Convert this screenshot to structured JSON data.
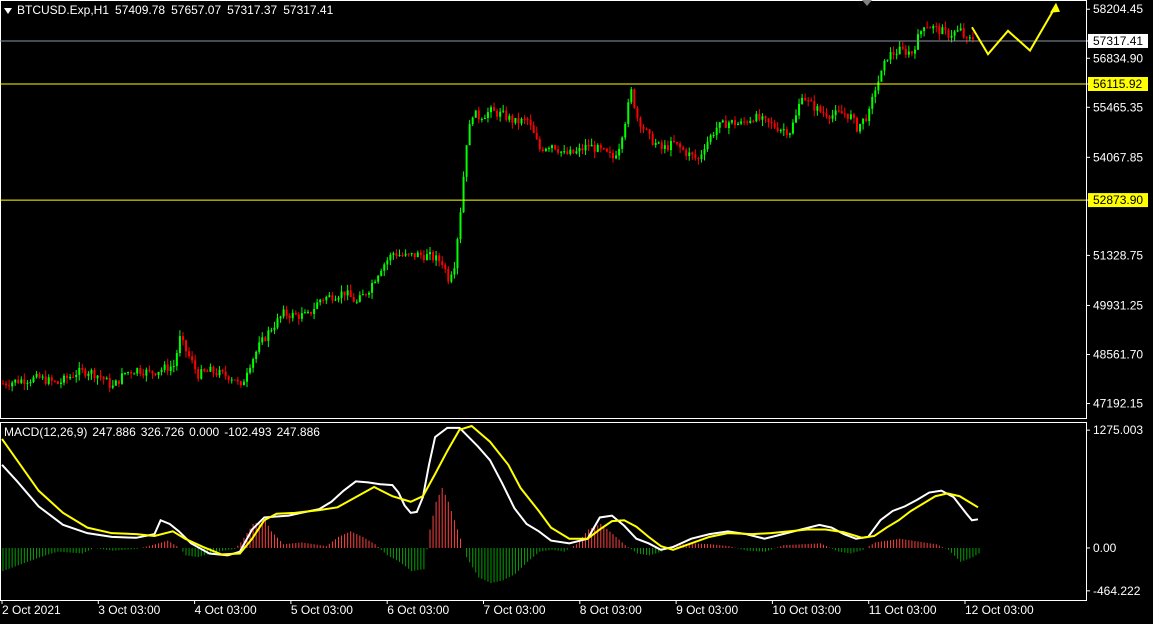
{
  "header": {
    "symbol": "BTCUSD.Exp,H1",
    "open": "57409.78",
    "high": "57657.07",
    "low": "57317.37",
    "close": "57317.41"
  },
  "macd_header": {
    "name": "MACD(12,26,9)",
    "v1": "247.886",
    "v2": "326.726",
    "v3": "0.000",
    "v4": "-102.493",
    "v5": "247.886"
  },
  "colors": {
    "background": "#000000",
    "grid_frame": "#ffffff",
    "bull_candle": "#00ff00",
    "bear_candle": "#ff0000",
    "level_line": "#ffff00",
    "current_price_line": "#8a93a6",
    "macd_line": "#ffffff",
    "signal_line": "#ffff00",
    "hist_positive": "#ff4040",
    "hist_negative": "#00a000",
    "arrow": "#ffff00"
  },
  "chart_data": [
    {
      "type": "candlestick",
      "price_axis_labels": [
        "58204.45",
        "57317.41",
        "56834.90",
        "56115.92",
        "55465.35",
        "54067.85",
        "52873.90",
        "51328.75",
        "49931.25",
        "48561.70",
        "47192.15"
      ],
      "ylim": [
        46900,
        58350
      ],
      "current_price": 57317.41,
      "horizontal_levels": [
        {
          "label": "56115.92",
          "value": 56115.92
        },
        {
          "label": "52873.90",
          "value": 52873.9
        }
      ],
      "time_labels": [
        "2 Oct 2021",
        "3 Oct 03:00",
        "4 Oct 03:00",
        "5 Oct 03:00",
        "6 Oct 03:00",
        "7 Oct 03:00",
        "8 Oct 03:00",
        "9 Oct 03:00",
        "10 Oct 03:00",
        "11 Oct 03:00",
        "12 Oct 03:00"
      ],
      "price_path": [
        [
          0,
          47750
        ],
        [
          6,
          47850
        ],
        [
          12,
          47900
        ],
        [
          18,
          47750
        ],
        [
          24,
          48050
        ],
        [
          28,
          48100
        ],
        [
          32,
          47950
        ],
        [
          36,
          47650
        ],
        [
          40,
          48050
        ],
        [
          44,
          48150
        ],
        [
          48,
          48050
        ],
        [
          52,
          48150
        ],
        [
          56,
          48250
        ],
        [
          58,
          49000
        ],
        [
          61,
          48500
        ],
        [
          64,
          48000
        ],
        [
          68,
          48100
        ],
        [
          72,
          48000
        ],
        [
          76,
          47900
        ],
        [
          78,
          47600
        ],
        [
          80,
          48150
        ],
        [
          84,
          48800
        ],
        [
          88,
          49300
        ],
        [
          92,
          49700
        ],
        [
          96,
          49650
        ],
        [
          100,
          49650
        ],
        [
          104,
          50100
        ],
        [
          108,
          50200
        ],
        [
          112,
          50300
        ],
        [
          116,
          50000
        ],
        [
          120,
          50400
        ],
        [
          124,
          51000
        ],
        [
          128,
          51400
        ],
        [
          132,
          51300
        ],
        [
          136,
          51350
        ],
        [
          140,
          51300
        ],
        [
          144,
          51150
        ],
        [
          146,
          50700
        ],
        [
          148,
          51100
        ],
        [
          150,
          52600
        ],
        [
          152,
          54500
        ],
        [
          154,
          55300
        ],
        [
          156,
          55200
        ],
        [
          160,
          55350
        ],
        [
          164,
          55250
        ],
        [
          168,
          55050
        ],
        [
          172,
          55100
        ],
        [
          176,
          54300
        ],
        [
          180,
          54450
        ],
        [
          184,
          54150
        ],
        [
          188,
          54200
        ],
        [
          192,
          54400
        ],
        [
          196,
          54250
        ],
        [
          200,
          54050
        ],
        [
          202,
          54400
        ],
        [
          204,
          55100
        ],
        [
          206,
          55900
        ],
        [
          208,
          55200
        ],
        [
          212,
          54600
        ],
        [
          216,
          54300
        ],
        [
          220,
          54450
        ],
        [
          224,
          54200
        ],
        [
          228,
          54000
        ],
        [
          230,
          54400
        ],
        [
          234,
          54900
        ],
        [
          238,
          55050
        ],
        [
          242,
          55000
        ],
        [
          246,
          55200
        ],
        [
          250,
          55050
        ],
        [
          254,
          54900
        ],
        [
          258,
          54800
        ],
        [
          260,
          55200
        ],
        [
          262,
          55850
        ],
        [
          264,
          55600
        ],
        [
          268,
          55350
        ],
        [
          272,
          55250
        ],
        [
          276,
          55300
        ],
        [
          278,
          55200
        ],
        [
          280,
          54900
        ],
        [
          284,
          55300
        ],
        [
          286,
          56000
        ],
        [
          288,
          56400
        ],
        [
          290,
          56900
        ],
        [
          294,
          57050
        ],
        [
          298,
          57000
        ],
        [
          302,
          57800
        ],
        [
          306,
          57650
        ],
        [
          310,
          57500
        ],
        [
          314,
          57600
        ],
        [
          316,
          57300
        ],
        [
          318,
          57400
        ]
      ],
      "forecast_arrow_points": [
        [
          57700
        ],
        [
          56950
        ],
        [
          57600
        ],
        [
          57050
        ],
        [
          58300
        ]
      ]
    },
    {
      "type": "line",
      "title": "MACD(12,26,9)",
      "axis_labels": [
        "1275.003",
        "0.00",
        "-464.222"
      ],
      "ylim": [
        -520,
        1320
      ],
      "macd_line": [
        [
          0,
          900
        ],
        [
          5,
          720
        ],
        [
          12,
          450
        ],
        [
          20,
          250
        ],
        [
          28,
          160
        ],
        [
          36,
          120
        ],
        [
          44,
          110
        ],
        [
          50,
          150
        ],
        [
          52,
          300
        ],
        [
          55,
          260
        ],
        [
          58,
          180
        ],
        [
          62,
          50
        ],
        [
          68,
          -60
        ],
        [
          74,
          -80
        ],
        [
          78,
          -40
        ],
        [
          82,
          200
        ],
        [
          86,
          330
        ],
        [
          90,
          340
        ],
        [
          94,
          350
        ],
        [
          98,
          380
        ],
        [
          104,
          420
        ],
        [
          108,
          500
        ],
        [
          112,
          620
        ],
        [
          116,
          720
        ],
        [
          120,
          710
        ],
        [
          124,
          690
        ],
        [
          128,
          680
        ],
        [
          130,
          600
        ],
        [
          132,
          460
        ],
        [
          134,
          380
        ],
        [
          136,
          390
        ],
        [
          138,
          550
        ],
        [
          140,
          900
        ],
        [
          142,
          1200
        ],
        [
          146,
          1300
        ],
        [
          150,
          1300
        ],
        [
          156,
          1100
        ],
        [
          160,
          950
        ],
        [
          164,
          700
        ],
        [
          168,
          430
        ],
        [
          172,
          260
        ],
        [
          176,
          180
        ],
        [
          180,
          80
        ],
        [
          186,
          50
        ],
        [
          192,
          100
        ],
        [
          196,
          330
        ],
        [
          200,
          350
        ],
        [
          204,
          240
        ],
        [
          208,
          100
        ],
        [
          212,
          50
        ],
        [
          216,
          -20
        ],
        [
          220,
          10
        ],
        [
          226,
          100
        ],
        [
          232,
          150
        ],
        [
          238,
          180
        ],
        [
          244,
          150
        ],
        [
          250,
          100
        ],
        [
          256,
          150
        ],
        [
          262,
          200
        ],
        [
          268,
          250
        ],
        [
          272,
          220
        ],
        [
          276,
          150
        ],
        [
          280,
          100
        ],
        [
          284,
          120
        ],
        [
          288,
          300
        ],
        [
          292,
          400
        ],
        [
          296,
          450
        ],
        [
          300,
          520
        ],
        [
          304,
          600
        ],
        [
          308,
          620
        ],
        [
          312,
          550
        ],
        [
          316,
          380
        ],
        [
          318,
          300
        ],
        [
          320,
          310
        ]
      ],
      "signal_line": [
        [
          0,
          1180
        ],
        [
          6,
          900
        ],
        [
          12,
          620
        ],
        [
          20,
          380
        ],
        [
          28,
          220
        ],
        [
          36,
          160
        ],
        [
          44,
          150
        ],
        [
          50,
          130
        ],
        [
          56,
          180
        ],
        [
          60,
          100
        ],
        [
          66,
          10
        ],
        [
          72,
          -70
        ],
        [
          78,
          -60
        ],
        [
          82,
          100
        ],
        [
          86,
          300
        ],
        [
          90,
          370
        ],
        [
          96,
          380
        ],
        [
          104,
          410
        ],
        [
          110,
          440
        ],
        [
          116,
          550
        ],
        [
          122,
          660
        ],
        [
          128,
          560
        ],
        [
          134,
          500
        ],
        [
          138,
          560
        ],
        [
          142,
          800
        ],
        [
          146,
          1050
        ],
        [
          150,
          1280
        ],
        [
          154,
          1320
        ],
        [
          160,
          1150
        ],
        [
          166,
          900
        ],
        [
          170,
          650
        ],
        [
          176,
          400
        ],
        [
          180,
          220
        ],
        [
          186,
          100
        ],
        [
          192,
          100
        ],
        [
          196,
          200
        ],
        [
          200,
          290
        ],
        [
          204,
          300
        ],
        [
          208,
          230
        ],
        [
          212,
          120
        ],
        [
          216,
          20
        ],
        [
          220,
          -20
        ],
        [
          226,
          50
        ],
        [
          232,
          120
        ],
        [
          238,
          160
        ],
        [
          246,
          150
        ],
        [
          252,
          160
        ],
        [
          258,
          180
        ],
        [
          264,
          200
        ],
        [
          270,
          200
        ],
        [
          276,
          170
        ],
        [
          282,
          110
        ],
        [
          286,
          130
        ],
        [
          290,
          220
        ],
        [
          294,
          300
        ],
        [
          298,
          400
        ],
        [
          302,
          480
        ],
        [
          306,
          560
        ],
        [
          310,
          590
        ],
        [
          314,
          560
        ],
        [
          318,
          480
        ],
        [
          320,
          440
        ]
      ],
      "histogram_envelope": [
        [
          0,
          -250
        ],
        [
          8,
          -150
        ],
        [
          14,
          -80
        ],
        [
          18,
          -40
        ],
        [
          26,
          -60
        ],
        [
          30,
          0
        ],
        [
          36,
          -30
        ],
        [
          40,
          -20
        ],
        [
          44,
          -10
        ],
        [
          50,
          40
        ],
        [
          54,
          80
        ],
        [
          58,
          0
        ],
        [
          60,
          -80
        ],
        [
          64,
          -100
        ],
        [
          68,
          -60
        ],
        [
          72,
          -30
        ],
        [
          76,
          -10
        ],
        [
          78,
          60
        ],
        [
          82,
          260
        ],
        [
          86,
          300
        ],
        [
          88,
          180
        ],
        [
          92,
          40
        ],
        [
          98,
          60
        ],
        [
          102,
          40
        ],
        [
          106,
          20
        ],
        [
          110,
          120
        ],
        [
          114,
          180
        ],
        [
          118,
          120
        ],
        [
          122,
          40
        ],
        [
          126,
          -80
        ],
        [
          130,
          -150
        ],
        [
          134,
          -250
        ],
        [
          138,
          -230
        ],
        [
          140,
          200
        ],
        [
          142,
          500
        ],
        [
          144,
          650
        ],
        [
          146,
          500
        ],
        [
          148,
          300
        ],
        [
          150,
          100
        ],
        [
          152,
          -100
        ],
        [
          156,
          -320
        ],
        [
          160,
          -380
        ],
        [
          164,
          -350
        ],
        [
          168,
          -280
        ],
        [
          172,
          -150
        ],
        [
          176,
          -40
        ],
        [
          180,
          -20
        ],
        [
          184,
          -40
        ],
        [
          188,
          40
        ],
        [
          192,
          200
        ],
        [
          196,
          260
        ],
        [
          200,
          150
        ],
        [
          204,
          30
        ],
        [
          208,
          -60
        ],
        [
          212,
          -80
        ],
        [
          216,
          -40
        ],
        [
          220,
          30
        ],
        [
          226,
          50
        ],
        [
          232,
          40
        ],
        [
          238,
          20
        ],
        [
          244,
          -30
        ],
        [
          250,
          -40
        ],
        [
          256,
          30
        ],
        [
          262,
          40
        ],
        [
          268,
          50
        ],
        [
          274,
          -40
        ],
        [
          278,
          -60
        ],
        [
          282,
          -20
        ],
        [
          286,
          60
        ],
        [
          290,
          80
        ],
        [
          294,
          100
        ],
        [
          298,
          80
        ],
        [
          302,
          60
        ],
        [
          306,
          40
        ],
        [
          310,
          -20
        ],
        [
          314,
          -150
        ],
        [
          318,
          -100
        ],
        [
          320,
          -60
        ]
      ]
    }
  ]
}
